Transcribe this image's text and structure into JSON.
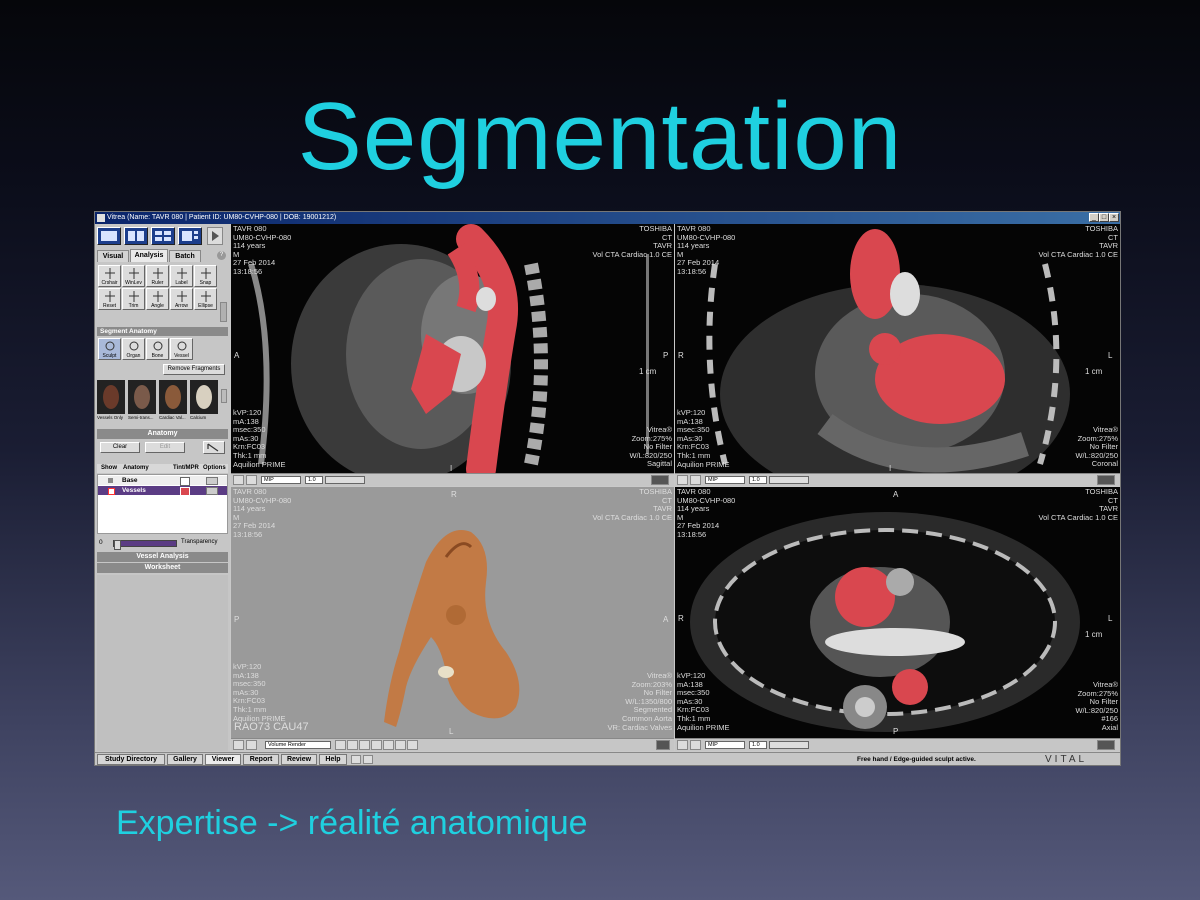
{
  "slide": {
    "title": "Segmentation",
    "subtitle": "Expertise -> réalité anatomique"
  },
  "app": {
    "title": "Vitrea (Name: TAVR 080 | Patient ID: UM80-CVHP-080 | DOB: 19001212)",
    "colors": {
      "accent_text": "#1fd0e0",
      "segmentation": "#d9474f",
      "vr_render": "#c27a45",
      "vr_bg": "#9a9a9a"
    }
  },
  "left_panel": {
    "tabs": [
      "Visual",
      "Analysis",
      "Batch"
    ],
    "tools": [
      {
        "label": "Crshair",
        "icon": "crosshair-icon"
      },
      {
        "label": "WinLev",
        "icon": "window-level-icon"
      },
      {
        "label": "Ruler",
        "icon": "ruler-icon"
      },
      {
        "label": "Label",
        "icon": "label-icon"
      },
      {
        "label": "Snap",
        "icon": "camera-icon"
      },
      {
        "label": "Reset",
        "icon": "reset-icon"
      },
      {
        "label": "Trim",
        "icon": "trim-icon"
      },
      {
        "label": "Angle",
        "icon": "angle-icon"
      },
      {
        "label": "Arrow",
        "icon": "arrow-icon"
      },
      {
        "label": "Ellipse",
        "icon": "ellipse-icon"
      }
    ],
    "segment_header": "Segment Anatomy",
    "segment_tools": [
      "Sculpt",
      "Organ",
      "Bone",
      "Vessel"
    ],
    "remove_fragments": "Remove Fragments",
    "presets": [
      "Vessels Only",
      "Semi-trans...",
      "Cardiac Val...",
      "Calcium"
    ],
    "anatomy_header": "Anatomy",
    "clear_label": "Clear",
    "edit_label": "Edit",
    "table_headers": [
      "Show",
      "Anatomy",
      "Tint/MPR",
      "Options"
    ],
    "anatomy_rows": [
      {
        "name": "Base",
        "selected": false
      },
      {
        "name": "Vessels",
        "selected": true
      }
    ],
    "transparency_value": "0",
    "transparency_label": "Transparency",
    "vessel_analysis": "Vessel Analysis",
    "worksheet": "Worksheet"
  },
  "viewports": {
    "sagittal": {
      "tl": "TAVR 080\nUM80-CVHP-080\n114 years\nM\n27 Feb 2014\n13:18:56",
      "tr": "TOSHIBA\nCT\nTAVR\nVol CTA Cardiac 1.0 CE",
      "bl": "kVP:120\nmA:138\nmsec:350\nmAs:30\nKrn:FC03\nThk:1 mm\nAquilion PRIME",
      "br": "Vitrea®\nZoom:275%\nNo Filter\nW/L:820/250\nSagittal",
      "left_ori": "A",
      "right_ori": "P",
      "bottom_ori": "I",
      "scale": "1 cm",
      "mode": "MIP",
      "slab": "1.0"
    },
    "coronal": {
      "tl": "TAVR 080\nUM80-CVHP-080\n114 years\nM\n27 Feb 2014\n13:18:56",
      "tr": "TOSHIBA\nCT\nTAVR\nVol CTA Cardiac 1.0 CE",
      "bl": "kVP:120\nmA:138\nmsec:350\nmAs:30\nKrn:FC03\nThk:1 mm\nAquilion PRIME",
      "br": "Vitrea®\nZoom:275%\nNo Filter\nW/L:820/250\nCoronal",
      "left_ori": "R",
      "right_ori": "L",
      "bottom_ori": "I",
      "scale": "1 cm",
      "mode": "MIP",
      "slab": "1.0"
    },
    "volume": {
      "tl": "TAVR 080\nUM80-CVHP-080\n114 years\nM\n27 Feb 2014\n13:18:56",
      "tr": "TOSHIBA\nCT\nTAVR\nVol CTA Cardiac 1.0 CE",
      "bl": "kVP:120\nmA:138\nmsec:350\nmAs:30\nKrn:FC03\nThk:1 mm\nAquilion PRIME",
      "angle": "RAO73 CAU47",
      "br": "Vitrea®\nZoom:203%\nNo Filter\nW/L:1350/800\nSegmented\nCommon Aorta\nVR: Cardiac Valves",
      "top_ori": "R",
      "left_ori": "P",
      "right_ori": "A",
      "bottom_ori": "L",
      "mode": "Volume Render"
    },
    "axial": {
      "tl": "TAVR 080\nUM80-CVHP-080\n114 years\nM\n27 Feb 2014\n13:18:56",
      "tr": "TOSHIBA\nCT\nTAVR\nVol CTA Cardiac 1.0 CE",
      "bl": "kVP:120\nmA:138\nmsec:350\nmAs:30\nKrn:FC03\nThk:1 mm\nAquilion PRIME",
      "br": "Vitrea®\nZoom:275%\nNo Filter\nW/L:820/250\n#166\nAxial",
      "top_ori": "A",
      "left_ori": "R",
      "right_ori": "L",
      "bottom_ori": "P",
      "scale": "1 cm",
      "mode": "MIP",
      "slab": "1.0"
    }
  },
  "bottom_tabs": [
    "Study Directory",
    "Gallery",
    "Viewer",
    "Report",
    "Review",
    "Help"
  ],
  "status": "Free hand / Edge-guided sculpt active.",
  "brand": "VITAL"
}
